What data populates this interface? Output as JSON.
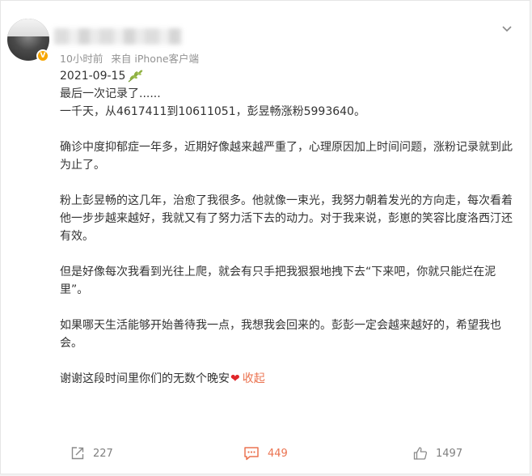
{
  "post": {
    "meta": {
      "time": "10小时前",
      "source": "来自 iPhone客户端"
    },
    "date": "2021-09-15",
    "paragraphs": [
      "最后一次记录了......",
      "一千天，从4617411到10611051，彭昱畅涨粉5993640。",
      "确诊中度抑郁症一年多，近期好像越来越严重了，心理原因加上时间问题，涨粉记录就到此为止了。",
      "粉上彭昱畅的这几年，治愈了我很多。他就像一束光，我努力朝着发光的方向走，每次看着他一步步越来越好，我就又有了努力活下去的动力。对于我来说，彭崽的笑容比度洛西汀还有效。",
      "但是好像每次我看到光往上爬，就会有只手把我狠狠地拽下去“下来吧，你就只能烂在泥里”。",
      "如果哪天生活能够开始善待我一点，我想我会回来的。彭彭一定会越来越好的，希望我也会。"
    ],
    "last_line": "谢谢这段时间里你们的无数个晚安",
    "heart": "❤",
    "collapse_label": "收起"
  },
  "footer": {
    "repost_count": "227",
    "comment_count": "449",
    "like_count": "1497"
  },
  "icons": {
    "more": "chevron-down-icon",
    "repost": "repost-icon",
    "comment": "comment-icon",
    "like": "thumbs-up-icon",
    "olive": "olive-branch-icon",
    "verified": "verified-badge-icon"
  },
  "colors": {
    "accent": "#eb7350",
    "meta_text": "#939393",
    "heart": "#e0262a",
    "verified": "#f7a600"
  }
}
